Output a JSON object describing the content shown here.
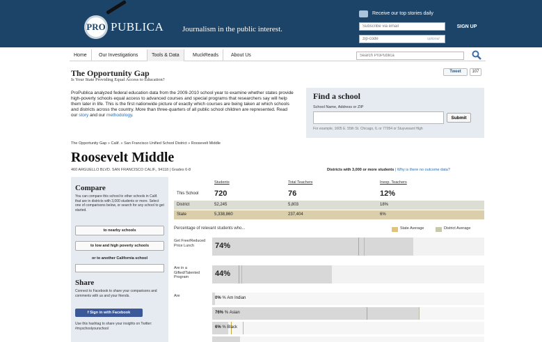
{
  "header": {
    "logo_pro": "PRO",
    "logo_publica": "PUBLICA",
    "tagline": "Journalism in the public interest.",
    "signup_text": "Receive our top stories daily",
    "email_placeholder": "Subscribe via email",
    "signup_button": "SIGN UP",
    "zip_placeholder": "zip-code",
    "zip_optional": "optional"
  },
  "nav": {
    "items": [
      "Home",
      "Our Investigations",
      "Tools & Data",
      "MuckReads",
      "About Us"
    ],
    "search_placeholder": "Search ProPublica"
  },
  "page": {
    "title": "The Opportunity Gap",
    "subtitle": "Is Your State Providing Equal Access to Education?",
    "tweet_label": "Tweet",
    "tweet_count": "107",
    "intro_text": "ProPublica analyzed federal education data from the 2009-2010 school year to examine whether states provide high-poverty schools equal access to advanced courses and special programs that researchers say will help them later in life. This is the first nationwide picture of exactly which courses are being taken at which schools and districts across the country. More than three-quarters of all public school children are represented. Read our ",
    "intro_link_story": "story",
    "intro_and": " and our ",
    "intro_link_method": "methodology",
    "intro_end": "."
  },
  "find": {
    "title": "Find a school",
    "label": "School Name, Address or ZIP",
    "submit": "Submit",
    "example": "For example, 1605 E. 55th St. Chicago, IL or 77054 or Stuyvesant High"
  },
  "school": {
    "breadcrumb": "The Opportunity Gap » Calif. » San Francisco Unified School District » Roosevelt Middle",
    "name": "Roosevelt Middle",
    "address": "460 ARGUELLO BLVD. SAN FRANCISCO CALIF., 94118 | Grades 6-8",
    "district_note": "Districts with 3,000 or more students",
    "district_link": "| Why is there no outcome data?"
  },
  "sidebar": {
    "compare_title": "Compare",
    "compare_desc": "You can compare this school to other schools in Calif. that are in districts with 3,000 students or more. Select one of comparisons below, or search for any school to get started.",
    "btn_nearby": "to nearby schools",
    "btn_poverty": "to low and high poverty schools",
    "label_another": "or to another California school",
    "share_title": "Share",
    "share_desc": "Connect to Facebook to share your comparisons and comments with us and your friends.",
    "fb_button": "f  Sign in with Facebook",
    "hashtag_note": "Use this hashtag to share your insights on Twitter: #myschoolyourschool"
  },
  "stats": {
    "headers": [
      "Students",
      "Total Teachers",
      "Inexp. Teachers"
    ],
    "rows": [
      {
        "label": "This School",
        "students": "720",
        "teachers": "76",
        "inexp": "12%"
      },
      {
        "label": "District",
        "students": "52,245",
        "teachers": "5,803",
        "inexp": "18%"
      },
      {
        "label": "State",
        "students": "5,338,860",
        "teachers": "237,404",
        "inexp": "6%"
      }
    ]
  },
  "metrics": {
    "intro": "Percentage of relevant students who...",
    "legend_state": "State Average",
    "legend_district": "District Average",
    "state_color": "#e0c47a",
    "district_color": "#c7c9ad",
    "free_lunch_label": "Get Free/Reduced Price Lunch",
    "free_lunch_pct": "74%",
    "free_lunch_value": 74,
    "gifted_label": "Are in a Gifted/Talented Program",
    "gifted_pct": "44%",
    "gifted_value": 44,
    "race_label": "Are",
    "race": [
      {
        "pct": "0%",
        "sep": "%",
        "name": "Am Indian",
        "value": 0
      },
      {
        "pct": "76%",
        "sep": "%",
        "name": "Asian",
        "value": 76
      },
      {
        "pct": "6%",
        "sep": "%",
        "name": "Black",
        "value": 6
      }
    ]
  }
}
